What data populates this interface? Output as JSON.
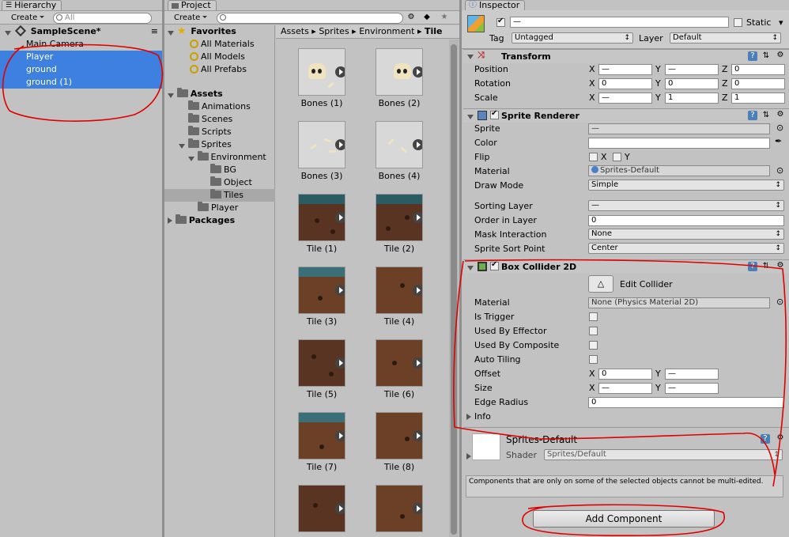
{
  "hierarchy": {
    "tab": "Hierarchy",
    "create": "Create",
    "search_placeholder": "All",
    "scene": "SampleScene*",
    "items": [
      "Main Camera",
      "Player",
      "ground",
      "ground (1)"
    ]
  },
  "project": {
    "tab": "Project",
    "create": "Create",
    "favorites": {
      "label": "Favorites",
      "items": [
        "All Materials",
        "All Models",
        "All Prefabs"
      ]
    },
    "tree": {
      "assets": "Assets",
      "animations": "Animations",
      "scenes": "Scenes",
      "scripts": "Scripts",
      "sprites": "Sprites",
      "environment": "Environment",
      "bg": "BG",
      "object": "Object",
      "tiles": "Tiles",
      "player": "Player",
      "packages": "Packages"
    },
    "breadcrumb": [
      "Assets",
      "Sprites",
      "Environment",
      "Tile"
    ],
    "assets": [
      "Bones (1)",
      "Bones (2)",
      "Bones (3)",
      "Bones (4)",
      "Tile (1)",
      "Tile (2)",
      "Tile (3)",
      "Tile (4)",
      "Tile (5)",
      "Tile (6)",
      "Tile (7)",
      "Tile (8)",
      "",
      ""
    ]
  },
  "inspector": {
    "tab": "Inspector",
    "name_value": "—",
    "static_label": "Static",
    "tag_label": "Tag",
    "tag_value": "Untagged",
    "layer_label": "Layer",
    "layer_value": "Default",
    "transform": {
      "title": "Transform",
      "position": {
        "label": "Position",
        "x": "—",
        "y": "—",
        "z": "0"
      },
      "rotation": {
        "label": "Rotation",
        "x": "0",
        "y": "0",
        "z": "0"
      },
      "scale": {
        "label": "Scale",
        "x": "—",
        "y": "1",
        "z": "1"
      }
    },
    "sprite_renderer": {
      "title": "Sprite Renderer",
      "sprite_label": "Sprite",
      "sprite_value": "—",
      "color_label": "Color",
      "flip_label": "Flip",
      "flip_x": "X",
      "flip_y": "Y",
      "material_label": "Material",
      "material_value": "Sprites-Default",
      "draw_mode_label": "Draw Mode",
      "draw_mode_value": "Simple",
      "sorting_layer_label": "Sorting Layer",
      "sorting_layer_value": "—",
      "order_label": "Order in Layer",
      "order_value": "0",
      "mask_label": "Mask Interaction",
      "mask_value": "None",
      "sort_point_label": "Sprite Sort Point",
      "sort_point_value": "Center"
    },
    "box_collider": {
      "title": "Box Collider 2D",
      "edit_collider": "Edit Collider",
      "material_label": "Material",
      "material_value": "None (Physics Material 2D)",
      "is_trigger": "Is Trigger",
      "used_by_effector": "Used By Effector",
      "used_by_composite": "Used By Composite",
      "auto_tiling": "Auto Tiling",
      "offset_label": "Offset",
      "offset_x": "0",
      "offset_y": "—",
      "size_label": "Size",
      "size_x": "—",
      "size_y": "—",
      "edge_radius_label": "Edge Radius",
      "edge_radius_value": "0",
      "info_label": "Info"
    },
    "material_footer": {
      "name": "Sprites-Default",
      "shader_label": "Shader",
      "shader_value": "Sprites/Default"
    },
    "note": "Components that are only on some of the selected objects cannot be multi-edited.",
    "add_component": "Add Component",
    "axis": {
      "x": "X",
      "y": "Y",
      "z": "Z"
    }
  },
  "colors": {
    "selection": "#3d80df",
    "annotation": "#e00000",
    "panel": "#c2c2c2"
  }
}
